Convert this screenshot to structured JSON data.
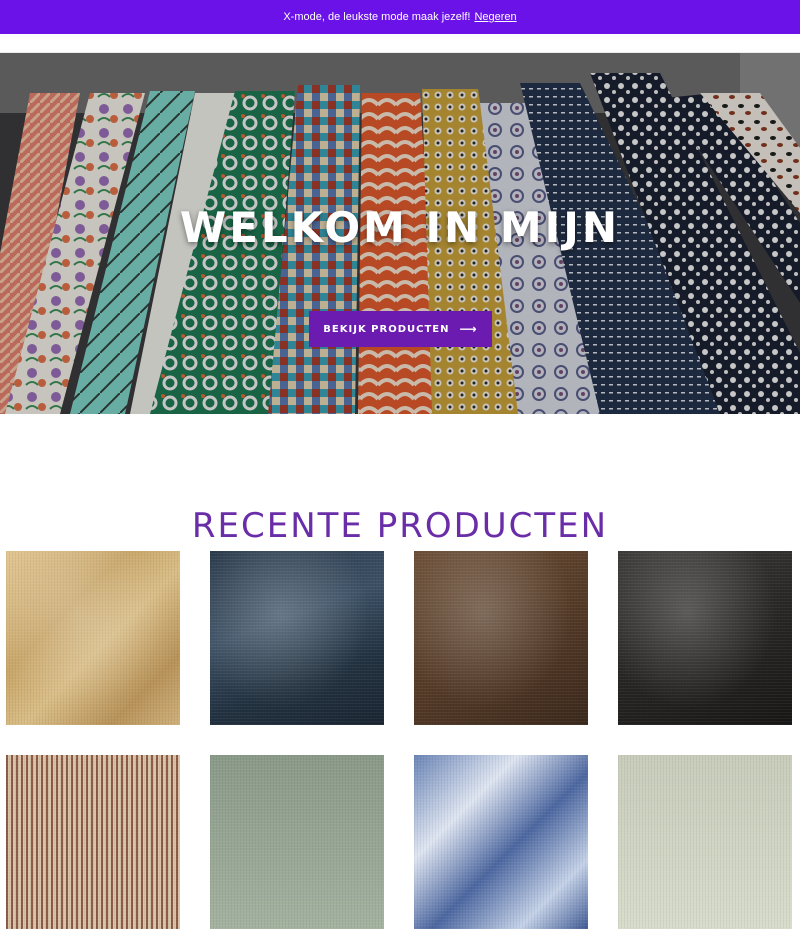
{
  "announcement": {
    "text": "X-mode, de leukste mode maak jezelf!",
    "dismiss_label": "Negeren"
  },
  "hero": {
    "title": "WELKOM IN MIJN",
    "button_label": "BEKIJK PRODUCTEN",
    "button_icon": "arrow-right-icon"
  },
  "recent": {
    "title": "RECENTE PRODUCTEN"
  },
  "colors": {
    "announcement_bg": "#6a12e8",
    "accent": "#6b1bb0",
    "section_title": "#6a2da8"
  }
}
